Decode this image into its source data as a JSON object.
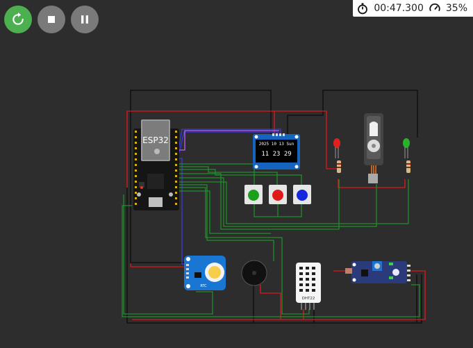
{
  "toolbar": {
    "restart_icon": "restart-icon",
    "stop_icon": "stop-icon",
    "pause_icon": "pause-icon"
  },
  "status": {
    "timer": "00:47.300",
    "speed": "35%"
  },
  "components": {
    "esp32_label": "ESP32",
    "oled_header": "2025 10 13 Sun",
    "oled_time": "11 23 29",
    "rtc_label": "RTC",
    "dht_label": "DHT22"
  },
  "colors": {
    "background": "#2d2d2d",
    "restart": "#4caf50",
    "wire_red": "#e0161b",
    "wire_black": "#111111",
    "wire_green": "#1f8f2a",
    "wire_blue": "#2c2cd9",
    "board_blue": "#1565c0"
  }
}
